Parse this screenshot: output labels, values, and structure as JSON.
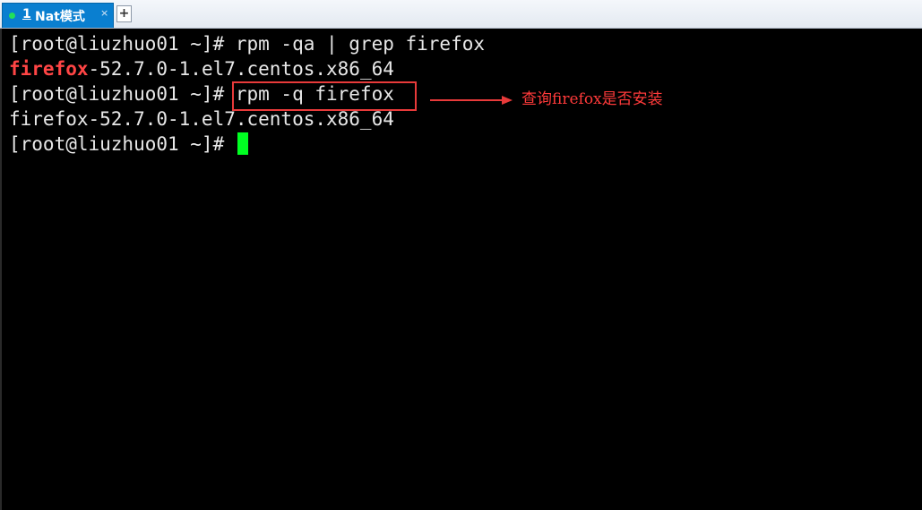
{
  "tab": {
    "number": "1",
    "name": "Nat模式",
    "close_glyph": "×",
    "status_color": "#22e05a"
  },
  "new_tab": {
    "label": "+"
  },
  "terminal": {
    "lines": [
      {
        "prompt": "[root@liuzhuo01 ~]#",
        "command": " rpm -qa | grep firefox"
      },
      {
        "highlight": "firefox",
        "rest": "-52.7.0-1.el7.centos.x86_64"
      },
      {
        "prompt": "[root@liuzhuo01 ~]#",
        "command": " rpm -q firefox"
      },
      {
        "text": "firefox-52.7.0-1.el7.centos.x86_64"
      },
      {
        "prompt": "[root@liuzhuo01 ~]#",
        "command": " "
      }
    ],
    "cursor_color": "#00ff22",
    "highlight_color": "#ff4545"
  },
  "annotation": {
    "text": "查询firefox是否安装",
    "color": "#ff3a3a"
  }
}
